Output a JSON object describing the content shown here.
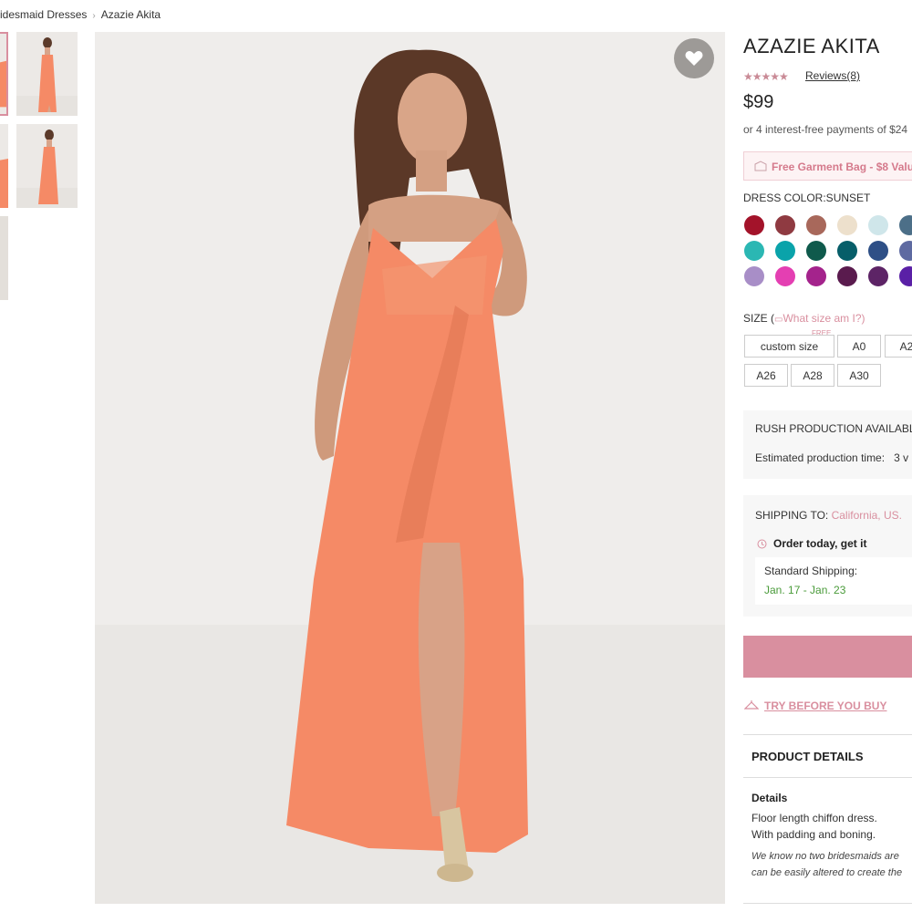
{
  "breadcrumb": {
    "parent": "ridesmaid Dresses",
    "current": "Azazie Akita"
  },
  "product": {
    "title": "AZAZIE AKITA",
    "stars": "★★★★★",
    "reviews": "Reviews(8)",
    "price": "$99",
    "installment": "or 4 interest-free payments of $24",
    "promo": "Free Garment Bag - $8 Valu"
  },
  "color": {
    "label": "DRESS COLOR:SUNSET",
    "swatches": [
      "#a3132a",
      "#8f3a41",
      "#a8685b",
      "#ede0cc",
      "#cfe6ea",
      "#4c6f88",
      "#2bb7b3",
      "#0aa3aa",
      "#0f5a4c",
      "#075e69",
      "#2e4f86",
      "#5e6aa1",
      "#a88ec7",
      "#e43fb2",
      "#a4238c",
      "#5a1b4e",
      "#5d2466",
      "#5a20a6"
    ]
  },
  "size": {
    "label": "SIZE (",
    "help": "What size am I?)",
    "free": "FREE",
    "options": [
      "custom size",
      "A0",
      "A2",
      "A26",
      "A28",
      "A30"
    ]
  },
  "rush": {
    "title": "RUSH PRODUCTION AVAILABLE",
    "estimate": "Estimated production time:",
    "estimate_value": "3 v"
  },
  "shipping": {
    "label": "SHIPPING TO:",
    "location": "California, US.",
    "order_today": "Order today,  get it",
    "method": "Standard Shipping:",
    "dates": "Jan. 17 - Jan. 23"
  },
  "try_before": "TRY BEFORE YOU BUY",
  "details": {
    "header": "PRODUCT DETAILS",
    "subheader": "Details",
    "line1": "Floor length chiffon dress.",
    "line2": "With padding and boning.",
    "note1": "We know no two bridesmaids are",
    "note2": "can be easily altered to create the"
  },
  "colors": {
    "accent": "#d98f9f",
    "dress": "#f58a66",
    "ship_date": "#4a9b3a"
  }
}
